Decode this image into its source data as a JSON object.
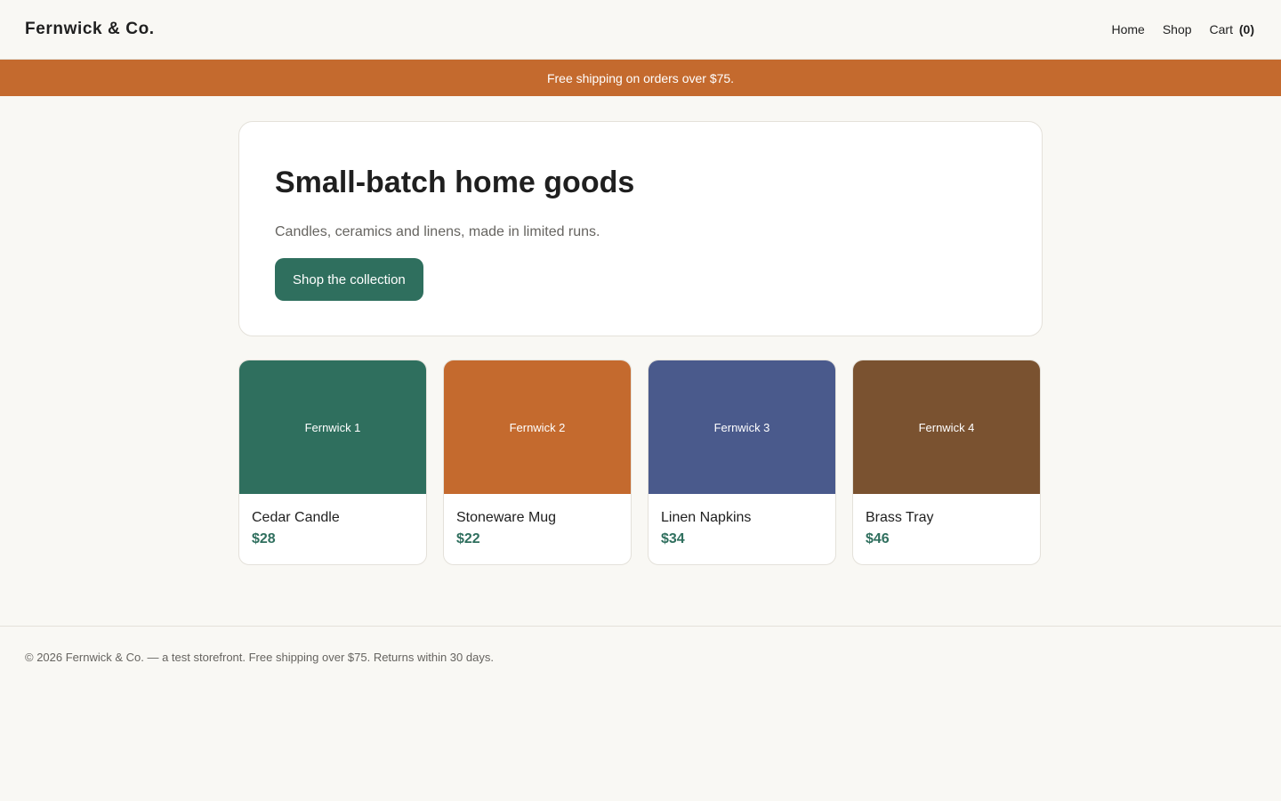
{
  "header": {
    "brand": "Fernwick & Co.",
    "nav": {
      "home": "Home",
      "shop": "Shop",
      "cart_label": "Cart",
      "cart_count": "(0)"
    }
  },
  "banner": {
    "text": "Free shipping on orders over $75."
  },
  "hero": {
    "title": "Small-batch home goods",
    "subtitle": "Candles, ceramics and linens, made in limited runs.",
    "cta_label": "Shop the collection"
  },
  "products": [
    {
      "image_label": "Fernwick 1",
      "name": "Cedar Candle",
      "price": "$28",
      "color": "#2f6f5e"
    },
    {
      "image_label": "Fernwick 2",
      "name": "Stoneware Mug",
      "price": "$22",
      "color": "#c46a2e"
    },
    {
      "image_label": "Fernwick 3",
      "name": "Linen Napkins",
      "price": "$34",
      "color": "#4a5a8c"
    },
    {
      "image_label": "Fernwick 4",
      "name": "Brass Tray",
      "price": "$46",
      "color": "#7a5230"
    }
  ],
  "footer": {
    "text": "© 2026 Fernwick & Co. — a test storefront. Free shipping over $75. Returns within 30 days."
  },
  "colors": {
    "accent": "#c46a2e",
    "primary": "#2f6f5e",
    "background": "#f9f8f4"
  }
}
